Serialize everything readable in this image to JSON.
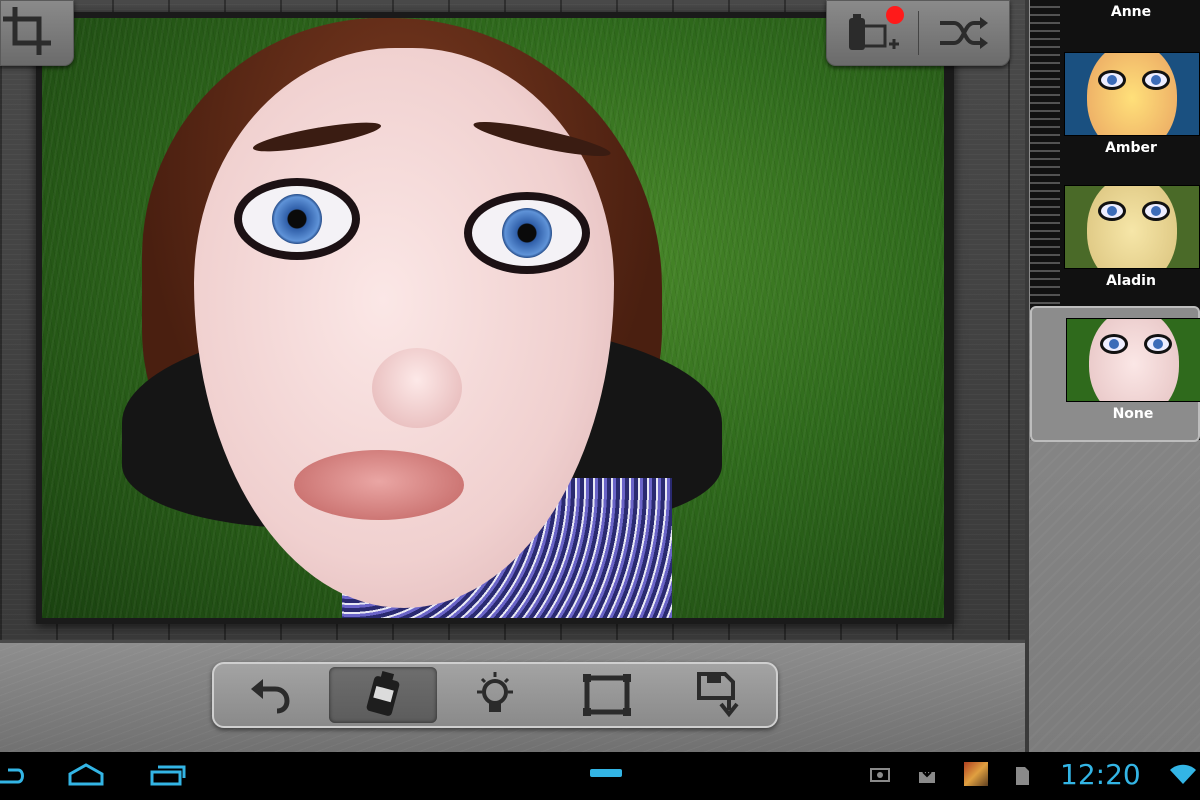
{
  "filters": {
    "items": [
      {
        "label": "Anne"
      },
      {
        "label": "Amber"
      },
      {
        "label": "Aladin"
      },
      {
        "label": "None"
      }
    ],
    "selected": "None"
  },
  "toolbar": {
    "tools": [
      "undo-icon",
      "film-roll-icon",
      "lightbulb-icon",
      "frame-icon",
      "save-icon"
    ],
    "active_tool": "film-roll-icon"
  },
  "top_tools": [
    "crop-icon",
    "add-film-icon",
    "shuffle-icon"
  ],
  "status_bar": {
    "time": "12:20"
  },
  "colors": {
    "accent_clock": "#33b5e5",
    "notification_dot": "#ff1a1a"
  }
}
